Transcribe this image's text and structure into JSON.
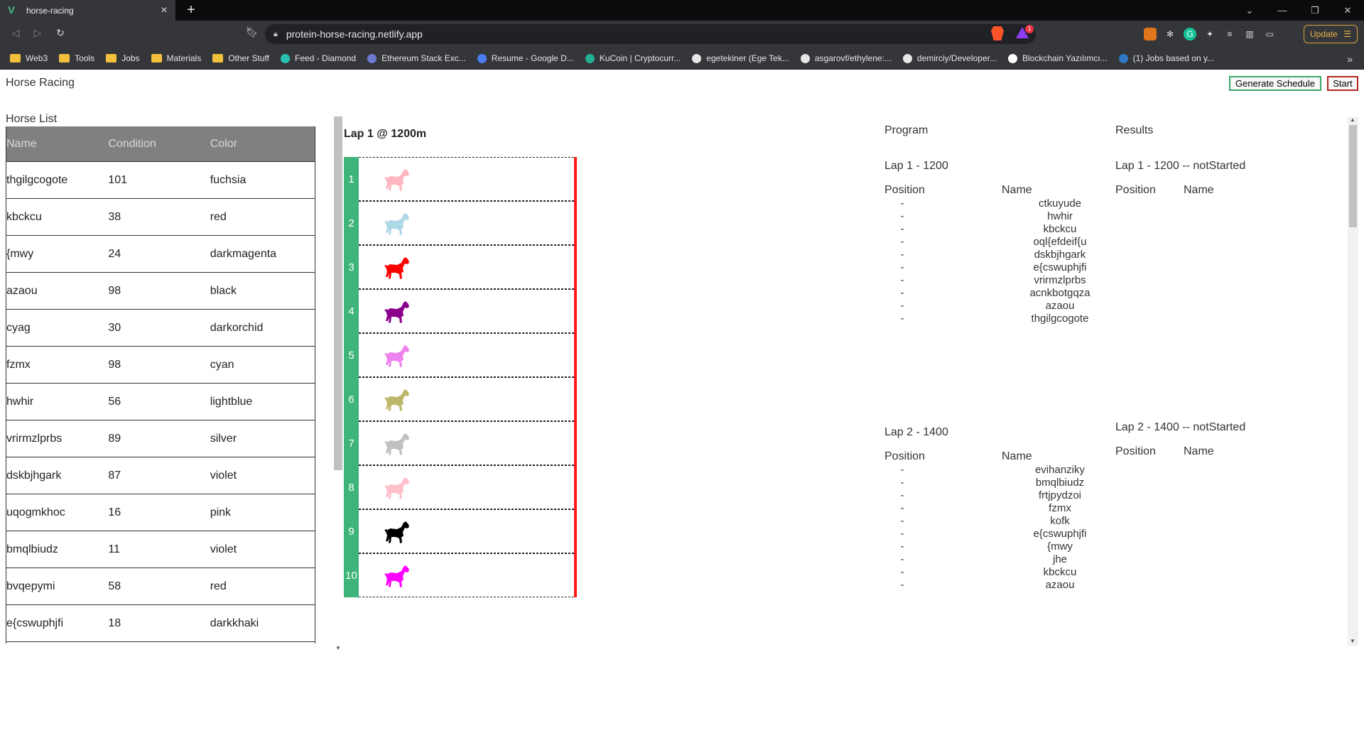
{
  "browser": {
    "tab_title": "horse-racing",
    "url": "protein-horse-racing.netlify.app",
    "update_label": "Update",
    "rewards_badge": "1",
    "bookmarks": [
      {
        "label": "Web3",
        "icon": "folder-icon"
      },
      {
        "label": "Tools",
        "icon": "folder-icon"
      },
      {
        "label": "Jobs",
        "icon": "folder-icon"
      },
      {
        "label": "Materials",
        "icon": "folder-icon"
      },
      {
        "label": "Other Stuff",
        "icon": "folder-icon"
      },
      {
        "label": "Feed - Diamond",
        "icon": "diamond-icon"
      },
      {
        "label": "Ethereum Stack Exc...",
        "icon": "stackexchange-icon"
      },
      {
        "label": "Resume - Google D...",
        "icon": "google-docs-icon"
      },
      {
        "label": "KuCoin | Cryptocurr...",
        "icon": "kucoin-icon"
      },
      {
        "label": "egetekiner (Ege Tek...",
        "icon": "github-icon"
      },
      {
        "label": "asgarovf/ethylene:...",
        "icon": "github-icon"
      },
      {
        "label": "demirciy/Developer...",
        "icon": "github-icon"
      },
      {
        "label": "Blockchain Yazılımcı...",
        "icon": "medium-icon"
      },
      {
        "label": "(1) Jobs based on y...",
        "icon": "linkedin-icon"
      }
    ]
  },
  "app": {
    "title": "Horse Racing",
    "generate_label": "Generate Schedule",
    "start_label": "Start"
  },
  "horse_list": {
    "title": "Horse List",
    "headers": [
      "Name",
      "Condition",
      "Color"
    ],
    "rows": [
      {
        "name": "thgilgcogote",
        "condition": "101",
        "color": "fuchsia"
      },
      {
        "name": "kbckcu",
        "condition": "38",
        "color": "red"
      },
      {
        "name": "{mwy",
        "condition": "24",
        "color": "darkmagenta"
      },
      {
        "name": "azaou",
        "condition": "98",
        "color": "black"
      },
      {
        "name": "cyag",
        "condition": "30",
        "color": "darkorchid"
      },
      {
        "name": "fzmx",
        "condition": "98",
        "color": "cyan"
      },
      {
        "name": "hwhir",
        "condition": "56",
        "color": "lightblue"
      },
      {
        "name": "vrirmzlprbs",
        "condition": "89",
        "color": "silver"
      },
      {
        "name": "dskbjhgark",
        "condition": "87",
        "color": "violet"
      },
      {
        "name": "uqogmkhoc",
        "condition": "16",
        "color": "pink"
      },
      {
        "name": "bmqlbiudz",
        "condition": "11",
        "color": "violet"
      },
      {
        "name": "bvqepymi",
        "condition": "58",
        "color": "red"
      },
      {
        "name": "e{cswuphjfi",
        "condition": "18",
        "color": "darkkhaki"
      }
    ]
  },
  "race": {
    "title": "Lap 1 @ 1200m",
    "lanes": [
      {
        "number": "1",
        "color": "#ffb6c1"
      },
      {
        "number": "2",
        "color": "#add8e6"
      },
      {
        "number": "3",
        "color": "#ff0000"
      },
      {
        "number": "4",
        "color": "#8b008b"
      },
      {
        "number": "5",
        "color": "#ee82ee"
      },
      {
        "number": "6",
        "color": "#bdb76b"
      },
      {
        "number": "7",
        "color": "#c0c0c0"
      },
      {
        "number": "8",
        "color": "#ffc0cb"
      },
      {
        "number": "9",
        "color": "#000000"
      },
      {
        "number": "10",
        "color": "#ff00ff"
      }
    ]
  },
  "program": {
    "title": "Program",
    "position_header": "Position",
    "name_header": "Name",
    "laps": [
      {
        "title": "Lap 1 - 1200",
        "entries": [
          {
            "pos": "-",
            "name": "ctkuyude"
          },
          {
            "pos": "-",
            "name": "hwhir"
          },
          {
            "pos": "-",
            "name": "kbckcu"
          },
          {
            "pos": "-",
            "name": "oql{efdeif{u"
          },
          {
            "pos": "-",
            "name": "dskbjhgark"
          },
          {
            "pos": "-",
            "name": "e{cswuphjfi"
          },
          {
            "pos": "-",
            "name": "vrirmzlprbs"
          },
          {
            "pos": "-",
            "name": "acnkbotgqza"
          },
          {
            "pos": "-",
            "name": "azaou"
          },
          {
            "pos": "-",
            "name": "thgilgcogote"
          }
        ]
      },
      {
        "title": "Lap 2 - 1400",
        "entries": [
          {
            "pos": "-",
            "name": "evihanziky"
          },
          {
            "pos": "-",
            "name": "bmqlbiudz"
          },
          {
            "pos": "-",
            "name": "frtjpydzoi"
          },
          {
            "pos": "-",
            "name": "fzmx"
          },
          {
            "pos": "-",
            "name": "kofk"
          },
          {
            "pos": "-",
            "name": "e{cswuphjfi"
          },
          {
            "pos": "-",
            "name": "{mwy"
          },
          {
            "pos": "-",
            "name": "jhe"
          },
          {
            "pos": "-",
            "name": "kbckcu"
          },
          {
            "pos": "-",
            "name": "azaou"
          }
        ]
      }
    ]
  },
  "results": {
    "title": "Results",
    "position_header": "Position",
    "name_header": "Name",
    "laps": [
      {
        "title": "Lap 1 - 1200 -- notStarted"
      },
      {
        "title": "Lap 2 - 1400 -- notStarted"
      }
    ]
  }
}
